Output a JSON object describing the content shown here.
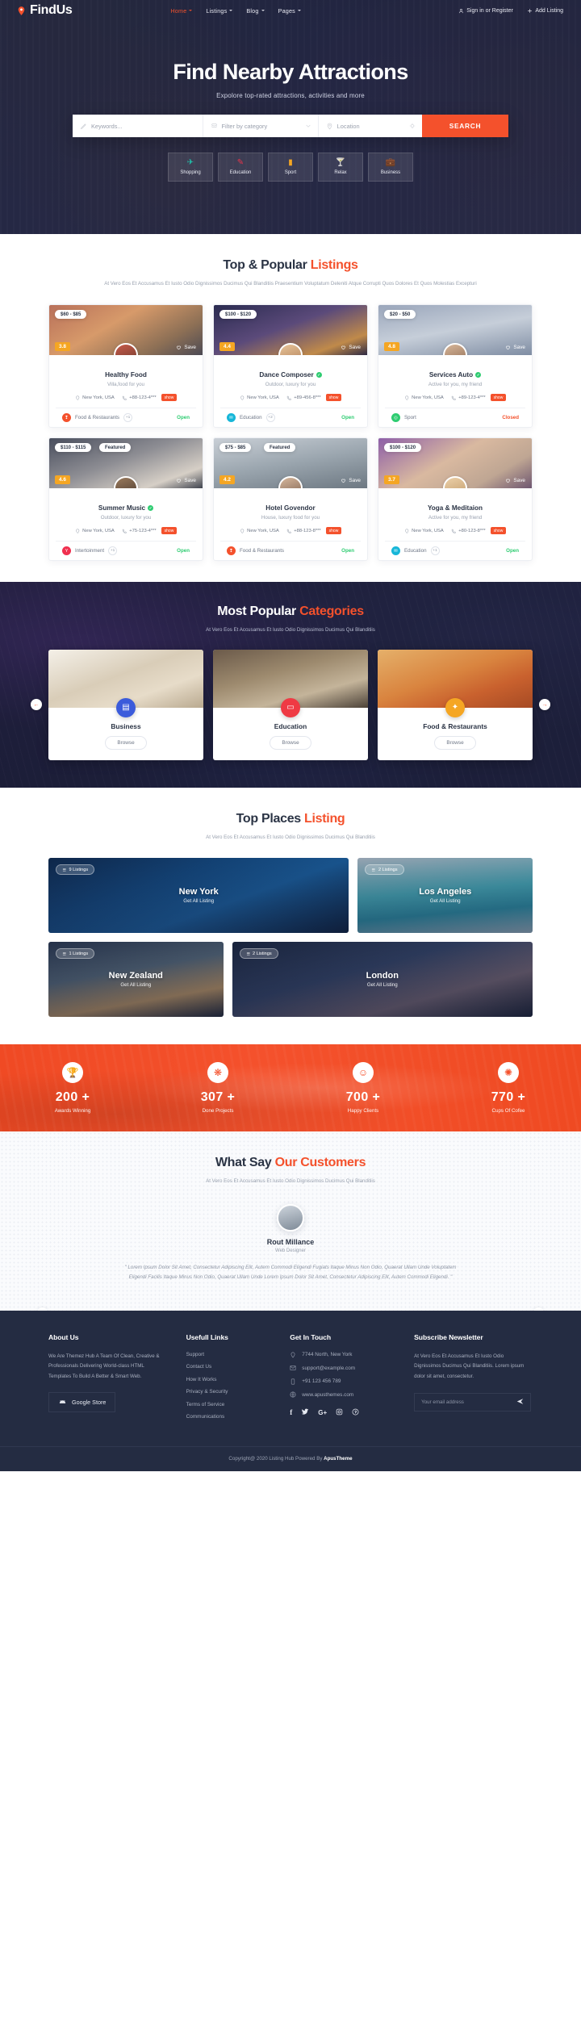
{
  "brand": {
    "name": "FindUs",
    "icon": "map-pin-icon"
  },
  "nav": {
    "items": [
      {
        "label": "Home",
        "caret": true,
        "active": true
      },
      {
        "label": "Listings",
        "caret": true,
        "active": false
      },
      {
        "label": "Blog",
        "caret": true,
        "active": false
      },
      {
        "label": "Pages",
        "caret": true,
        "active": false
      }
    ],
    "sign_in": "Sign in or Register",
    "add_listing": "Add Listing"
  },
  "hero": {
    "title": "Find Nearby Attractions",
    "subtitle": "Expolore top-rated attractions, activities and more",
    "search": {
      "keywords_placeholder": "Keywords...",
      "category_placeholder": "Filter by category",
      "location_placeholder": "Location",
      "button": "SEARCH"
    },
    "chips": [
      {
        "label": "Shopping",
        "glyph": "✈",
        "color": "#1ec8b0",
        "icon": "plane-icon"
      },
      {
        "label": "Education",
        "glyph": "✎",
        "color": "#e8344a",
        "icon": "pencil-icon"
      },
      {
        "label": "Sport",
        "glyph": "▯",
        "color": "#f5a623",
        "icon": "book-icon"
      },
      {
        "label": "Relax",
        "glyph": "Y",
        "color": "#2ecc71",
        "icon": "cocktail-icon"
      },
      {
        "label": "Business",
        "glyph": "▤",
        "color": "#a66bd4",
        "icon": "briefcase-icon"
      }
    ]
  },
  "listings": {
    "title_a": "Top & Popular ",
    "title_b": "Listings",
    "desc": "At Vero Eos Et Accusamus Et Iusto Odio Dignissimos Ducimus Qui Blanditiis Praesentium Voluptatum Deleniti Atque Corrupti Quos Dolores Et Quos Molestias Excepturi",
    "save_label": "Save",
    "show_label": "show",
    "cards": [
      {
        "price": "$60 - $85",
        "featured": "",
        "rating": "3.8",
        "title": "Healthy Food",
        "verified": false,
        "tagline": "Villa,food for you",
        "location": "New York, USA",
        "phone": "+88-123-4***",
        "category": "Food & Restaurants",
        "cat_color": "#f4512c",
        "cat_glyph": "❢",
        "extra": "+1",
        "status": "Open",
        "status_kind": "open",
        "img": "linear-gradient(150deg,#b8705a,#d79a6a 40%,#8c6f55 75%,#4c4a54)",
        "av": "linear-gradient(160deg,#c75a4a,#6b3a2c)"
      },
      {
        "price": "$100 - $120",
        "featured": "",
        "rating": "4.4",
        "title": "Dance Composer",
        "verified": true,
        "tagline": "Outdoor, luxury for you",
        "location": "New York, USA",
        "phone": "+89-456-8***",
        "category": "Education",
        "cat_color": "#16b6d8",
        "cat_glyph": "✉",
        "extra": "+2",
        "status": "Open",
        "status_kind": "open",
        "img": "linear-gradient(160deg,#2a2b50,#5b4a7a 45%,#c08a4a 80%,#2e2a44)",
        "av": "linear-gradient(160deg,#e8c49a,#b07f56)"
      },
      {
        "price": "$20 - $50",
        "featured": "",
        "rating": "4.8",
        "title": "Services Auto",
        "verified": true,
        "tagline": "Active for you, my friend",
        "location": "New York, USA",
        "phone": "+89-123-4***",
        "category": "Sport",
        "cat_color": "#2ecc71",
        "cat_glyph": "◎",
        "extra": "",
        "status": "Closed",
        "status_kind": "closed",
        "img": "linear-gradient(170deg,#9aa6bb,#c6ced9 50%,#7f8da3)",
        "av": "linear-gradient(160deg,#d8b79a,#8d6a52)"
      },
      {
        "price": "$110 - $115",
        "featured": "Featured",
        "rating": "4.6",
        "title": "Summer Music",
        "verified": true,
        "tagline": "Outdoor, luxury for you",
        "location": "New York, USA",
        "phone": "+75-123-4***",
        "category": "Intertoinment",
        "cat_color": "#f0304f",
        "cat_glyph": "Y",
        "extra": "+1",
        "status": "Open",
        "status_kind": "open",
        "img": "linear-gradient(160deg,#4a4f5e,#8d8d93 45%,#d6cfc6 80%,#3f434e)",
        "av": "linear-gradient(160deg,#9a7a5c,#4a3a30)"
      },
      {
        "price": "$75 - $85",
        "featured": "Featured",
        "rating": "4.2",
        "title": "Hotel Govendor",
        "verified": false,
        "tagline": "House, luxury food for you",
        "location": "New York, USA",
        "phone": "+88-123-8***",
        "category": "Food & Restaurants",
        "cat_color": "#f4512c",
        "cat_glyph": "❢",
        "extra": "",
        "status": "Open",
        "status_kind": "open",
        "img": "linear-gradient(170deg,#c9cfd6,#9aa5ae 50%,#6d7882)",
        "av": "linear-gradient(160deg,#d6b79c,#7d6150)"
      },
      {
        "price": "$100 - $120",
        "featured": "",
        "rating": "3.7",
        "title": "Yoga & Meditaion",
        "verified": false,
        "tagline": "Active for you, my friend",
        "location": "New York, USA",
        "phone": "+80-123-8***",
        "category": "Education",
        "cat_color": "#16b6d8",
        "cat_glyph": "✉",
        "extra": "+1",
        "status": "Open",
        "status_kind": "open",
        "img": "linear-gradient(150deg,#8e5fa8,#d9b9a0 45%,#bfa693 75%,#6e5670)",
        "av": "linear-gradient(160deg,#ecd0a8,#c09a6a)"
      }
    ]
  },
  "categories": {
    "title_a": "Most Popular ",
    "title_b": "Categories",
    "desc": "At Vero Eos Et Accusamus Et Iusto Odio Dignissimos Ducimus Qui Blanditiis",
    "browse_label": "Browse",
    "prev": "←",
    "next": "→",
    "items": [
      {
        "label": "Business",
        "color": "#3b5bdb",
        "glyph": "▤",
        "icon": "briefcase-icon",
        "img": "linear-gradient(160deg,#f4f0e8,#d9cdb8 45%,#e7dcc9 70%,#b9a98f)"
      },
      {
        "label": "Education",
        "color": "#ef3a44",
        "glyph": "▭",
        "icon": "board-icon",
        "img": "linear-gradient(165deg,#6b5a4a,#9d8a6e 40%,#c4b49a 70%,#4c4238)"
      },
      {
        "label": "Food & Restaurants",
        "color": "#f5a623",
        "glyph": "✦",
        "icon": "food-icon",
        "img": "linear-gradient(160deg,#e5b06a,#d9843f 45%,#c9612e 70%,#a64a24)"
      }
    ]
  },
  "places": {
    "title_a": "Top Places ",
    "title_b": "Listing",
    "desc": "At Vero Eos Et Accusamus Et Iusto Odio Dignissimos Ducimus Qui Blanditiis",
    "sub_label": "Get All Listing",
    "items": [
      {
        "name": "New York",
        "listings": "9 Listings",
        "img": "linear-gradient(160deg,#0c2b52,#12518e 35%,#1a6ab0 60%,#0a2140)"
      },
      {
        "name": "Los Angeles",
        "listings": "2 Listings",
        "img": "linear-gradient(175deg,#c9d8e2,#4fc2cf 45%,#2f9fb6 70%,#a9c5d2)"
      },
      {
        "name": "New Zealand",
        "listings": "1 Listings",
        "img": "linear-gradient(170deg,#2b3a52,#5a6e7e 40%,#c9a06a 72%,#20293a)"
      },
      {
        "name": "London",
        "listings": "2 Listings",
        "img": "linear-gradient(165deg,#1b2740,#35466a 40%,#7a6a78 70%,#1a2236)"
      }
    ]
  },
  "stats": [
    {
      "value": "200 +",
      "label": "Awards Winning",
      "glyph": "🏆",
      "icon": "trophy-icon"
    },
    {
      "value": "307 +",
      "label": "Done Projects",
      "glyph": "❋",
      "icon": "layers-icon"
    },
    {
      "value": "700 +",
      "label": "Happy Clients",
      "glyph": "☺",
      "icon": "smiley-icon"
    },
    {
      "value": "770 +",
      "label": "Cups Of Cofee",
      "glyph": "✺",
      "icon": "coffee-icon"
    }
  ],
  "testimonial": {
    "title_a": "What Say ",
    "title_b": "Our Customers",
    "desc": "At Vero Eos Et Accusamus Et Iusto Odio Dignissimos Ducimus Qui Blanditiis",
    "name": "Rout Millance",
    "role": "Web Designer",
    "quote": "\" Lorem Ipsum Dolor Sit Amet, Consectetur Adipiscing Elit, Autem Commodi Eligendi Fugiats Itaque Minus Non Odio, Quaerat Ullam Unde Voluptatem Eligendi Facilis Itaque Minus Non Odio, Quaerat Ullam Unde Lorem Ipsum Dolor Sit Amet, Consectetur Adipiscing Elit, Autem Commodi Eligendi. \"",
    "prev": "←",
    "next": "→"
  },
  "footer": {
    "about": {
      "heading": "About Us",
      "text": "We Are Themez Hub A Team Of Clean, Creative & Professionals Delivering World-class HTML Templates To Build A Better & Smart Web.",
      "store_label": "Google Store"
    },
    "links": {
      "heading": "Usefull Links",
      "items": [
        "Support",
        "Contact Us",
        "How It Works",
        "Privacy & Security",
        "Terms of Service",
        "Communications"
      ]
    },
    "touch": {
      "heading": "Get In Touch",
      "address": "7744 North, New York",
      "email": "support@example.com",
      "phone": "+91 123 456 789",
      "web": "www.apusthemes.com",
      "socials": [
        "f",
        "🐦",
        "G+",
        "◎",
        "Ⓟ"
      ]
    },
    "newsletter": {
      "heading": "Subscribe Newsletter",
      "text": "At Vero Eos Et Accusamus Et Iusto Odio Dignissimos Ducimus Qui Blanditiis. Lorem ipsum dolor sit amet, consectetur.",
      "placeholder": "Your email address",
      "send_icon": "send-icon"
    },
    "copyright_a": "Copyright@ 2020 Listing Hub Powered By ",
    "copyright_b": "ApusTheme"
  }
}
